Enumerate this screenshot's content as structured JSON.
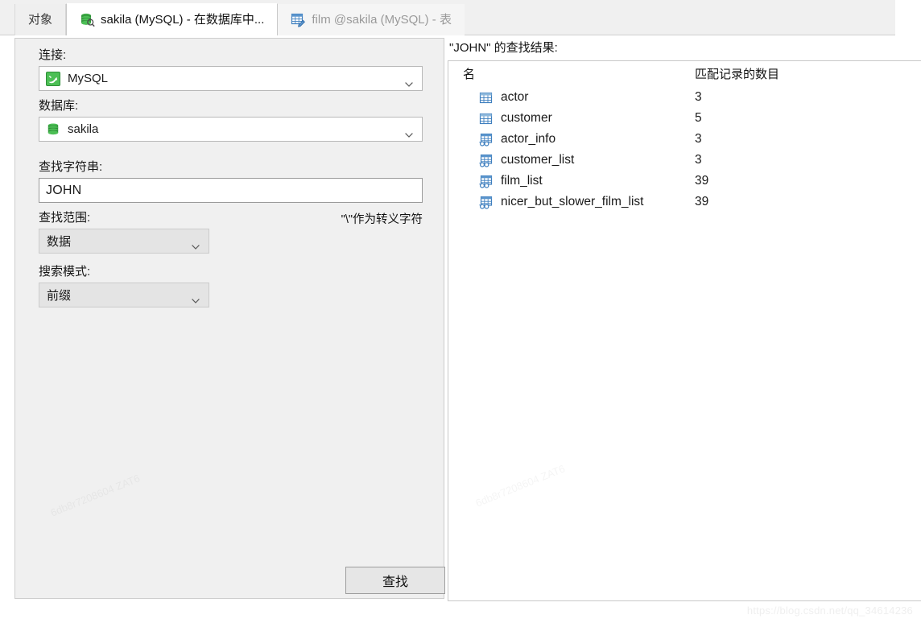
{
  "tabs": [
    {
      "label": "对象",
      "icon": "none",
      "state": "inactive"
    },
    {
      "label": "sakila (MySQL) - 在数据库中...",
      "icon": "database-search-icon",
      "state": "active"
    },
    {
      "label": "film @sakila (MySQL) - 表",
      "icon": "table-edit-icon",
      "state": "dim"
    }
  ],
  "form": {
    "connection_label": "连接:",
    "connection_value": "MySQL",
    "connection_icon": "mysql-dolphin-icon",
    "database_label": "数据库:",
    "database_value": "sakila",
    "database_icon": "database-icon",
    "find_string_label": "查找字符串:",
    "find_string_value": "JOHN",
    "find_string_placeholder": "",
    "find_range_label": "查找范围:",
    "find_range_value": "数据",
    "escape_note": "\"\\\"作为转义字符",
    "search_mode_label": "搜索模式:",
    "search_mode_value": "前缀",
    "find_button_label": "查找"
  },
  "results": {
    "caption": "\"JOHN\" 的查找结果:",
    "columns": [
      "名",
      "匹配记录的数目"
    ],
    "rows": [
      {
        "icon": "table-icon",
        "name": "actor",
        "count": "3"
      },
      {
        "icon": "table-icon",
        "name": "customer",
        "count": "5"
      },
      {
        "icon": "view-icon",
        "name": "actor_info",
        "count": "3"
      },
      {
        "icon": "view-icon",
        "name": "customer_list",
        "count": "3"
      },
      {
        "icon": "view-icon",
        "name": "film_list",
        "count": "39"
      },
      {
        "icon": "view-icon",
        "name": "nicer_but_slower_film_list",
        "count": "39"
      }
    ]
  },
  "watermark": {
    "url": "https://blog.csdn.net/qq_34614236",
    "faint": "6db8r7208604 ZAT6"
  },
  "colors": {
    "accent_green": "#3faa46",
    "accent_blue": "#3f7fbf",
    "panel_bg": "#f0f0f0",
    "active_tab_bg": "#ffffff"
  }
}
